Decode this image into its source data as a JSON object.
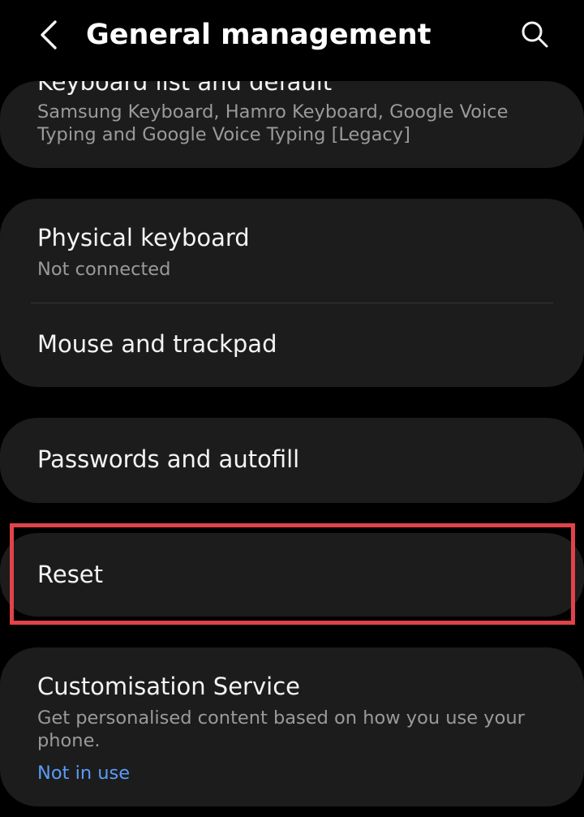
{
  "header": {
    "title": "General management",
    "back_icon": "chevron-left-icon",
    "search_icon": "search-icon"
  },
  "cards": {
    "keyboard_list": {
      "title": "Keyboard list and default",
      "subtitle": "Samsung Keyboard, Hamro Keyboard, Google Voice Typing and Google Voice Typing [Legacy]"
    },
    "physical_keyboard": {
      "title": "Physical keyboard",
      "subtitle": "Not connected"
    },
    "mouse_trackpad": {
      "title": "Mouse and trackpad"
    },
    "passwords_autofill": {
      "title": "Passwords and autofill"
    },
    "reset": {
      "title": "Reset"
    },
    "customisation_service": {
      "title": "Customisation Service",
      "subtitle": "Get personalised content based on how you use your phone.",
      "status": "Not in use"
    }
  },
  "colors": {
    "background": "#000000",
    "card": "#1c1c1c",
    "link": "#5a9cf8",
    "highlight": "#e0434a"
  }
}
